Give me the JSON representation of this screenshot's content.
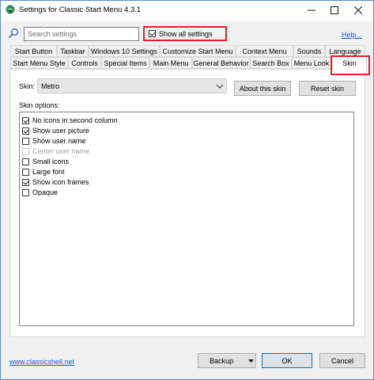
{
  "window": {
    "title": "Settings for Classic Start Menu 4.3.1",
    "buttons": [
      "minimize",
      "maximize",
      "close"
    ]
  },
  "search": {
    "placeholder": "Search settings",
    "show_all_label": "Show all settings",
    "show_all_checked": true,
    "help_label": "Help..."
  },
  "tabs": {
    "row1": [
      "Start Button",
      "Taskbar",
      "Windows 10 Settings",
      "Customize Start Menu",
      "Context Menu",
      "Sounds",
      "Language"
    ],
    "row2": [
      "Start Menu Style",
      "Controls",
      "Special Items",
      "Main Menu",
      "General Behavior",
      "Search Box",
      "Menu Look",
      "Skin"
    ],
    "active": "Skin"
  },
  "skin": {
    "label": "Skin:",
    "selected": "Metro",
    "about_button": "About this skin",
    "reset_button": "Reset skin",
    "options_label": "Skin options:",
    "options": [
      {
        "label": "No icons in second column",
        "checked": true,
        "enabled": true
      },
      {
        "label": "Show user picture",
        "checked": true,
        "enabled": true
      },
      {
        "label": "Show user name",
        "checked": false,
        "enabled": true
      },
      {
        "label": "Center user name",
        "checked": false,
        "enabled": false
      },
      {
        "label": "Small icons",
        "checked": false,
        "enabled": true
      },
      {
        "label": "Large font",
        "checked": false,
        "enabled": true
      },
      {
        "label": "Show icon frames",
        "checked": true,
        "enabled": true
      },
      {
        "label": "Opaque",
        "checked": false,
        "enabled": true
      }
    ]
  },
  "footer": {
    "website": "www.classicshell.net",
    "backup_label": "Backup",
    "ok_label": "OK",
    "cancel_label": "Cancel"
  },
  "colors": {
    "accent_link": "#0a5fd4",
    "highlight_red": "#e0222a",
    "window_border": "#5a8fc9"
  }
}
